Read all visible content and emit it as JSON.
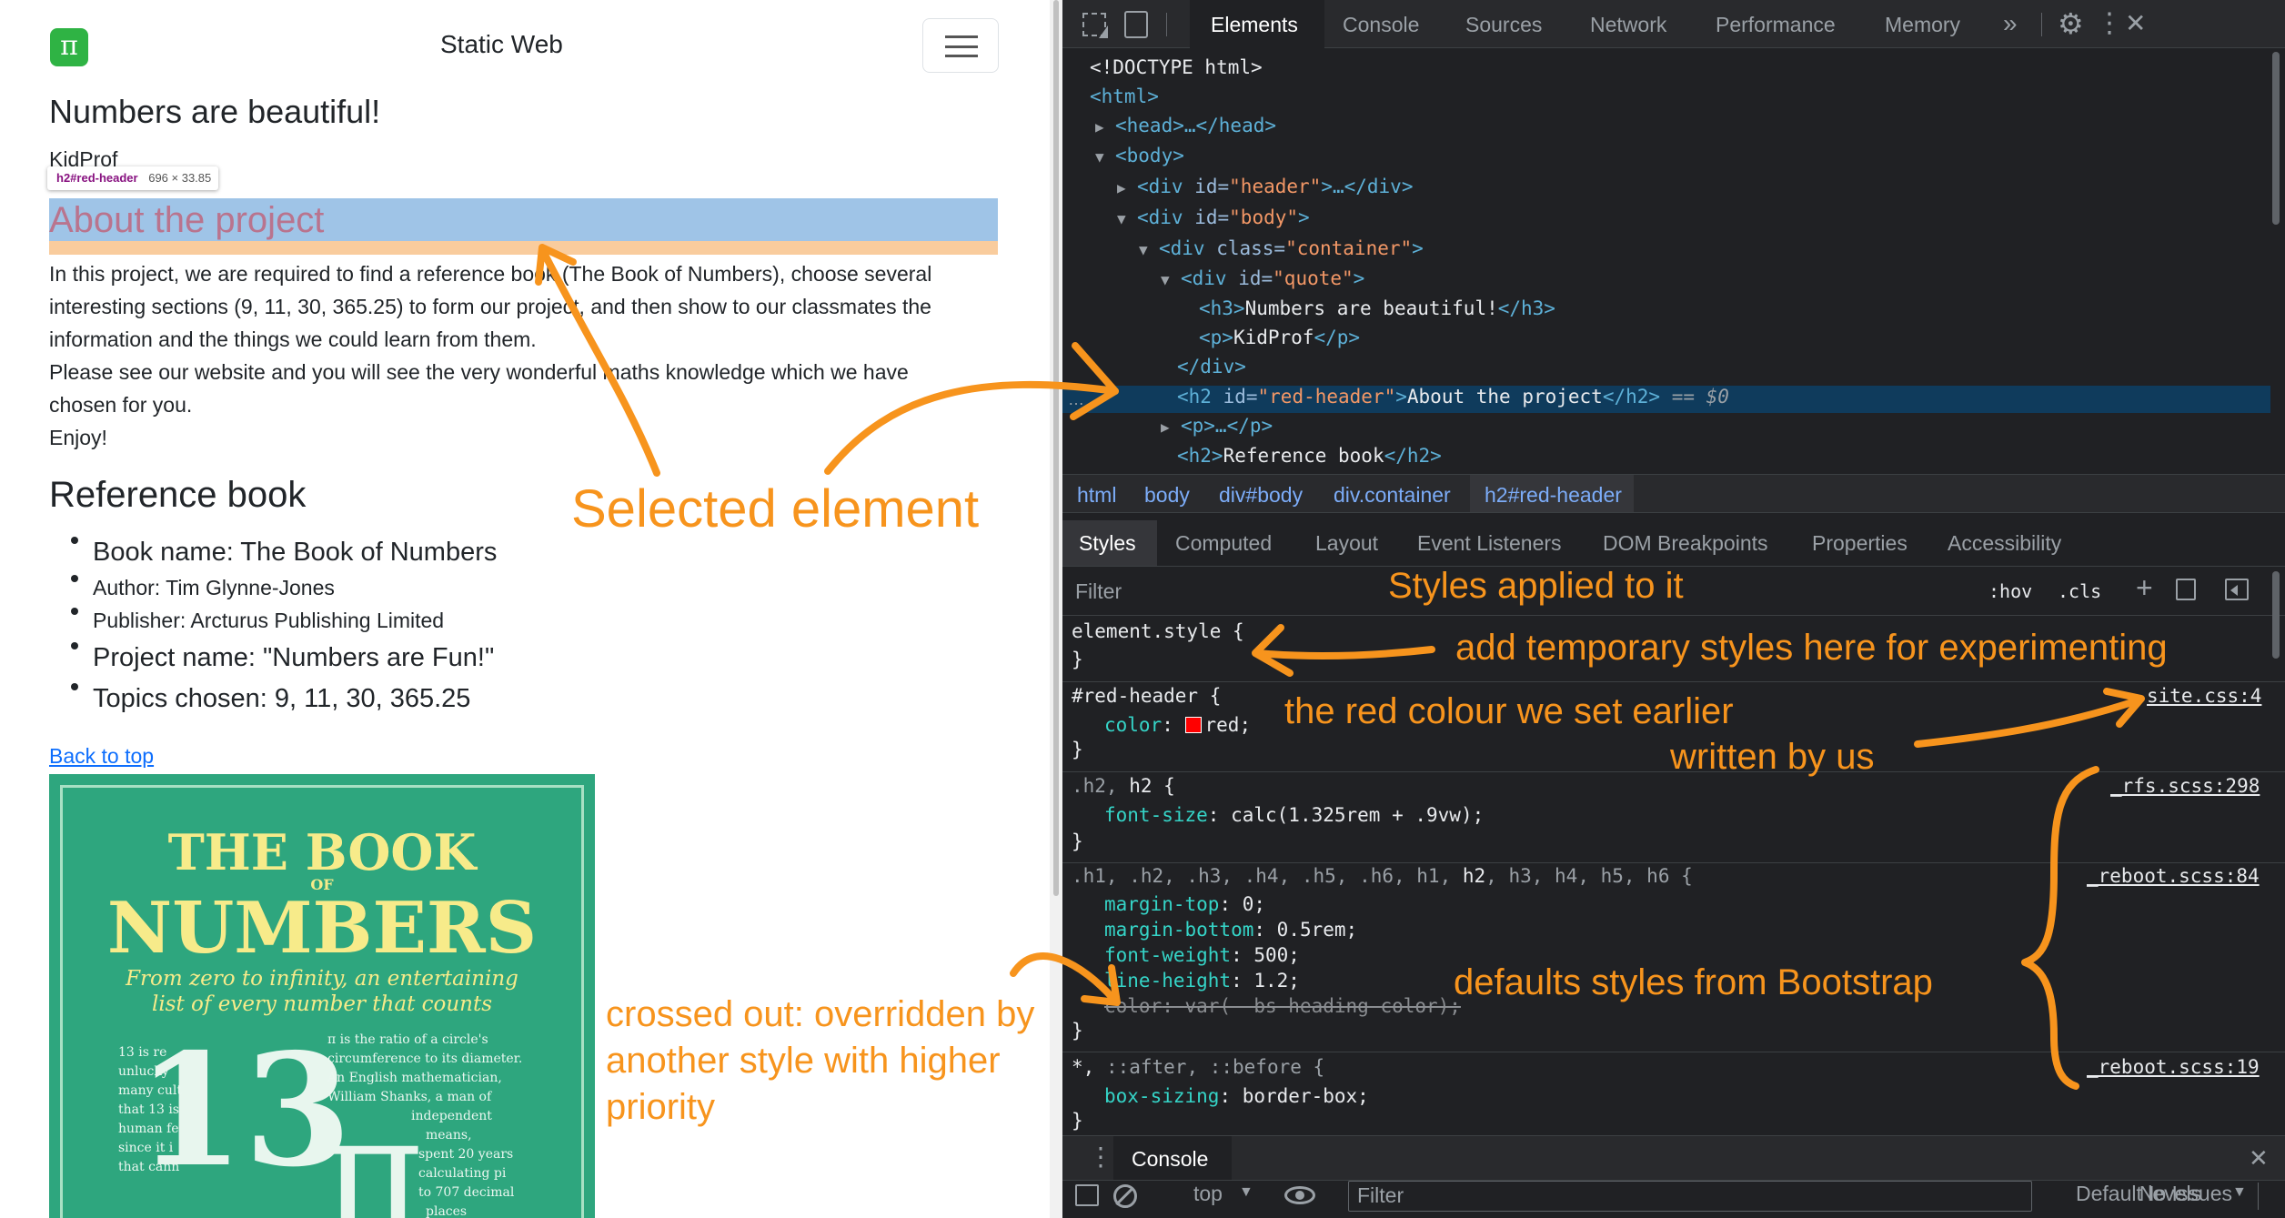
{
  "site": {
    "brand": "Static Web",
    "heading": "Numbers are beautiful!",
    "author": "KidProf",
    "tooltip": {
      "tag": "h2#red-header",
      "size": "696 × 33.85"
    },
    "section_title": "About the project",
    "para1_l1": "In this project, we are required to find a reference book (The Book of Numbers), choose several",
    "para1_l2": "interesting sections (9, 11, 30, 365.25) to form our project, and then show to our classmates the",
    "para1_l3": "information and the things we could learn from them.",
    "para2_l1": "Please see our website and you will see the very wonderful maths knowledge which we have",
    "para2_l2": "chosen for you.",
    "para3": "Enjoy!",
    "ref_title": "Reference book",
    "list": [
      "Book name: The Book of Numbers",
      "Author: Tim Glynne-Jones",
      "Publisher: Arcturus Publishing Limited",
      "Project name: \"Numbers are Fun!\"",
      "Topics chosen: 9, 11, 30, 365.25"
    ],
    "back_link": "Back to top",
    "cover": {
      "title1": "THE BOOK",
      "of": "OF",
      "title2": "NUMBERS",
      "sub1": "From zero to infinity, an entertaining",
      "sub2": "list of every number that counts",
      "num": "13",
      "pi": "π",
      "left_lines": [
        "13 is re",
        "unlucky",
        "many cult",
        "that 13 is",
        "human fe",
        "since it i",
        "that cann"
      ],
      "right_lines": [
        "π is the ratio of a circle's",
        "circumference to its diameter.",
        "An English mathematician,",
        "William Shanks, a man of",
        "independent",
        "means,",
        "spent 20 years",
        "calculating pi",
        "to 707 decimal",
        "places"
      ]
    }
  },
  "devtools": {
    "tabs": [
      "Elements",
      "Console",
      "Sources",
      "Network",
      "Performance",
      "Memory"
    ],
    "more": "»",
    "dom": {
      "doctype": "<!DOCTYPE html>",
      "html": "<html>",
      "head": "<head>…</head>",
      "body": "<body>",
      "header_div_tag": "<div ",
      "header_id_attr": "id=",
      "header_id_val": "\"header\"",
      "header_rest": ">…</div>",
      "body_div_tag": "<div ",
      "body_id_attr": "id=",
      "body_id_val": "\"body\"",
      "body_close": ">",
      "container_tag": "<div ",
      "container_attr": "class=",
      "container_val": "\"container\"",
      "container_close": ">",
      "quote_tag": "<div ",
      "quote_attr": "id=",
      "quote_val": "\"quote\"",
      "quote_close": ">",
      "h3_open": "<h3>",
      "h3_text": "Numbers are beautiful!",
      "h3_close": "</h3>",
      "p_open": "<p>",
      "p_text": "KidProf",
      "p_close": "</p>",
      "div_close": "</div>",
      "h2_open": "<h2 ",
      "h2_attr": "id=",
      "h2_val": "\"red-header\"",
      "h2_gt": ">",
      "h2_text": "About the project",
      "h2_close": "</h2>",
      "h2_eq": " == $0",
      "p_collapsed": "<p>…</p>",
      "h2b_open": "<h2>",
      "h2b_text": "Reference book",
      "h2b_close": "</h2>"
    },
    "breadcrumbs": [
      "html",
      "body",
      "div#body",
      "div.container",
      "h2#red-header"
    ],
    "subtabs": [
      "Styles",
      "Computed",
      "Layout",
      "Event Listeners",
      "DOM Breakpoints",
      "Properties",
      "Accessibility"
    ],
    "filter_placeholder": "Filter",
    "hov": ":hov",
    "cls": ".cls",
    "rules": {
      "el_sel": "element.style {",
      "close": "}",
      "r1_sel": "#red-header {",
      "r1_prop": "color",
      "r1_val": "red;",
      "r1_src": "site.css:4",
      "r2_sel_a": ".h2, ",
      "r2_sel_b": "h2 {",
      "r2_prop": "font-size",
      "r2_val": "calc(1.325rem + .9vw);",
      "r2_src": "_rfs.scss:298",
      "r3_sel_a": ".h1, .h2, .h3, .h4, .h5, .h6, h1, ",
      "r3_sel_b": "h2",
      "r3_sel_c": ", h3, h4, h5, h6 {",
      "r3_src": "_reboot.scss:84",
      "r3_p1": "margin-top",
      "r3_v1": "0;",
      "r3_p2": "margin-bottom",
      "r3_v2": "0.5rem;",
      "r3_p3": "font-weight",
      "r3_v3": "500;",
      "r3_p4": "line-height",
      "r3_v4": "1.2;",
      "r3_p5": "color",
      "r3_v5": "var(--bs-heading-color);",
      "r4_sel_a": "*, ",
      "r4_sel_b": "::after, ::before {",
      "r4_prop": "box-sizing",
      "r4_val": "border-box;",
      "r4_src": "_reboot.scss:19"
    },
    "drawer": {
      "title": "Console",
      "context": "top",
      "filter": "Filter",
      "levels": "Default levels",
      "issues": "No Issues"
    },
    "colors": {
      "red_swatch": "#ff0000",
      "selected_row": "#0f3b5c",
      "annotation": "#f7941d",
      "highlight_content": "#9fc4e7",
      "highlight_margin": "#f9cc9d"
    }
  },
  "annotations": {
    "selected": "Selected element",
    "styles": "Styles applied to it",
    "temp": "add temporary styles here for experimenting",
    "red": "the red colour we set earlier",
    "by_us": "written by us",
    "bootstrap": "defaults styles from Bootstrap",
    "crossed_l1": "crossed out: overridden by",
    "crossed_l2": "another style with higher",
    "crossed_l3": "priority"
  }
}
